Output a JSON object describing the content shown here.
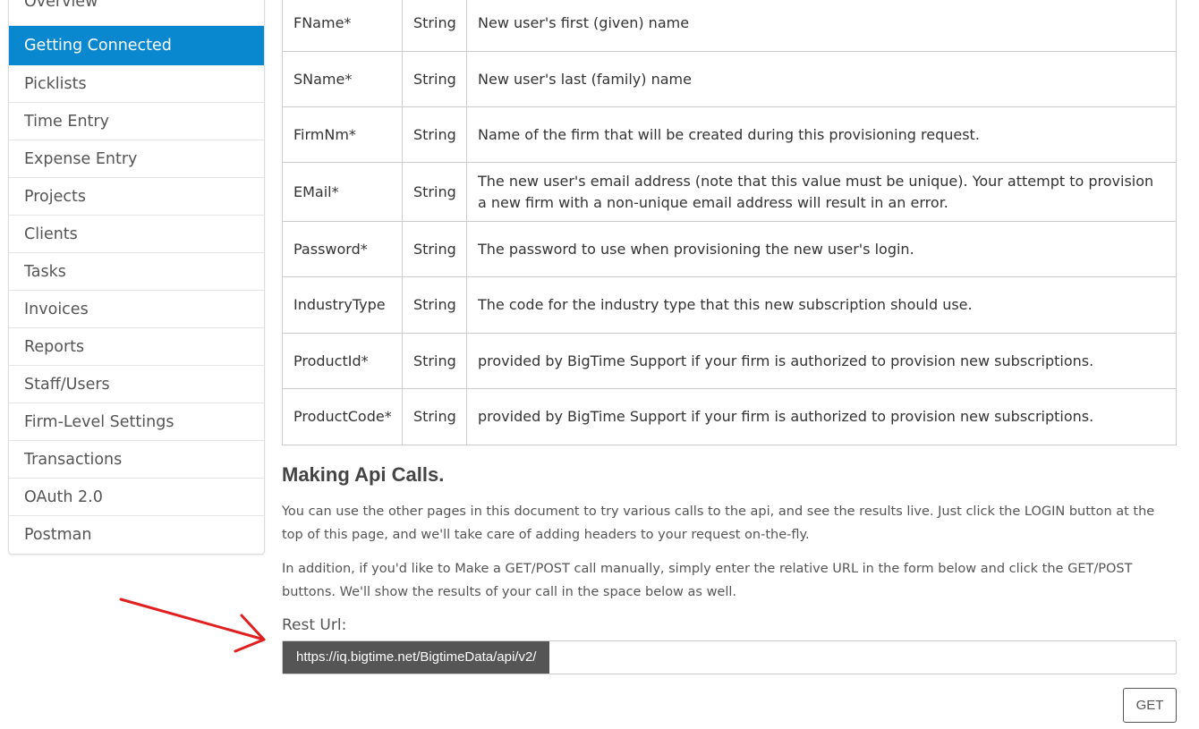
{
  "sidebar": {
    "items": [
      {
        "label": "Overview"
      },
      {
        "label": "Getting Connected",
        "active": true
      },
      {
        "label": "Picklists"
      },
      {
        "label": "Time Entry"
      },
      {
        "label": "Expense Entry"
      },
      {
        "label": "Projects"
      },
      {
        "label": "Clients"
      },
      {
        "label": "Tasks"
      },
      {
        "label": "Invoices"
      },
      {
        "label": "Reports"
      },
      {
        "label": "Staff/Users"
      },
      {
        "label": "Firm-Level Settings"
      },
      {
        "label": "Transactions"
      },
      {
        "label": "OAuth 2.0"
      },
      {
        "label": "Postman"
      }
    ],
    "active_color": "#0a88cf"
  },
  "params": {
    "rows": [
      {
        "name": "FName*",
        "type": "String",
        "description": "New user's first (given) name"
      },
      {
        "name": "SName*",
        "type": "String",
        "description": "New user's last (family) name"
      },
      {
        "name": "FirmNm*",
        "type": "String",
        "description": "Name of the firm that will be created during this provisioning request."
      },
      {
        "name": "EMail*",
        "type": "String",
        "description": "The new user's email address (note that this value must be unique). Your attempt to provision a new firm with a non-unique email address will result in an error."
      },
      {
        "name": "Password*",
        "type": "String",
        "description": "The password to use when provisioning the new user's login."
      },
      {
        "name": "IndustryType",
        "type": "String",
        "description": "The code for the industry type that this new subscription should use."
      },
      {
        "name": "ProductId*",
        "type": "String",
        "description": "provided by BigTime Support if your firm is authorized to provision new subscriptions."
      },
      {
        "name": "ProductCode*",
        "type": "String",
        "description": "provided by BigTime Support if your firm is authorized to provision new subscriptions."
      }
    ]
  },
  "section": {
    "title": "Making Api Calls.",
    "para1": "You can use the other pages in this document to try various calls to the api, and see the results live. Just click the LOGIN button at the top of this page, and we'll take care of adding headers to your request on-the-fly.",
    "para2": "In addition, if you'd like to Make a GET/POST call manually, simply enter the relative URL in the form below and click the GET/POST buttons. We'll show the results of your call in the space below as well."
  },
  "rest": {
    "label": "Rest Url:",
    "prefix": "https://iq.bigtime.net/BigtimeData/api/v2/",
    "value": "",
    "placeholder": ""
  },
  "get_button_label": "GET",
  "annotation": {
    "icon": "red-arrow-icon",
    "color": "#e02020"
  }
}
